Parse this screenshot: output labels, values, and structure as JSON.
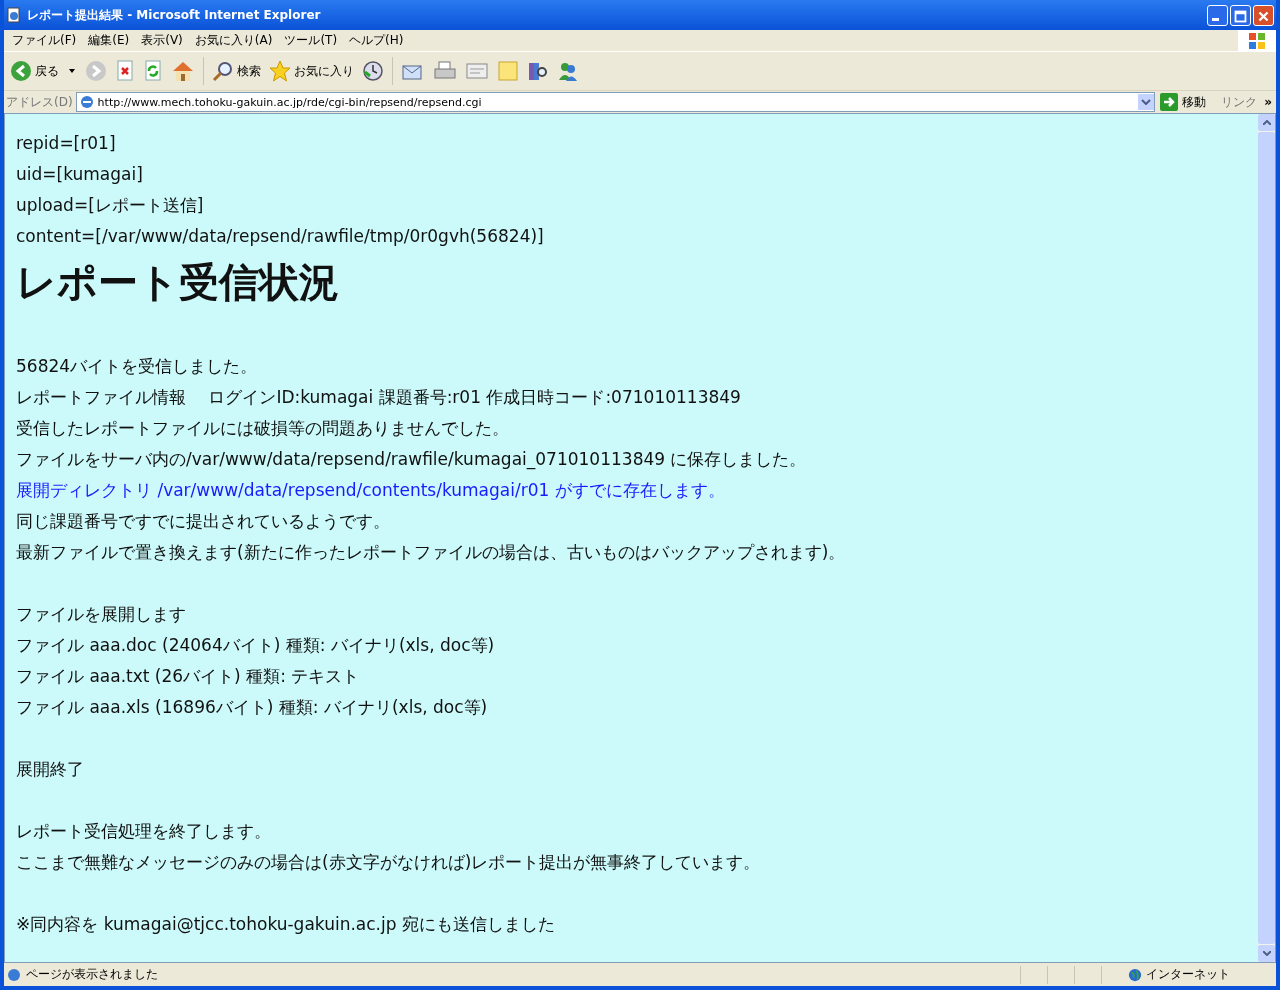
{
  "window": {
    "title": "レポート提出結果 - Microsoft Internet Explorer"
  },
  "menu": [
    {
      "label": "ファイル(F)"
    },
    {
      "label": "編集(E)"
    },
    {
      "label": "表示(V)"
    },
    {
      "label": "お気に入り(A)"
    },
    {
      "label": "ツール(T)"
    },
    {
      "label": "ヘルプ(H)"
    }
  ],
  "toolbar": {
    "back_label": "戻る",
    "search_label": "検索",
    "favorites_label": "お気に入り"
  },
  "address_bar": {
    "label": "アドレス(D)",
    "url": "http://www.mech.tohoku-gakuin.ac.jp/rde/cgi-bin/repsend/repsend.cgi",
    "go_label": "移動",
    "links_label": "リンク",
    "more": "»"
  },
  "content": [
    {
      "lines": [
        {
          "kind": "text",
          "text": "repid=[r01]"
        },
        {
          "kind": "text",
          "text": "uid=[kumagai]"
        },
        {
          "kind": "text",
          "text": "upload=[レポート送信]"
        },
        {
          "kind": "text",
          "text": "content=[/var/www/data/repsend/rawfile/tmp/0r0gvh(56824)]"
        },
        {
          "kind": "heading",
          "text": "レポート受信状況"
        }
      ]
    },
    {
      "lines": [
        {
          "kind": "text",
          "text": "56824バイトを受信しました。"
        },
        {
          "kind": "text",
          "text": "レポートファイル情報　 ログインID:kumagai 課題番号:r01 作成日時コード:071010113849"
        },
        {
          "kind": "text",
          "text": "受信したレポートファイルには破損等の問題ありませんでした。"
        },
        {
          "kind": "text",
          "text": "ファイルをサーバ内の/var/www/data/repsend/rawfile/kumagai_071010113849 に保存しました。"
        },
        {
          "kind": "notice",
          "text": "展開ディレクトリ /var/www/data/repsend/contents/kumagai/r01 がすでに存在します。"
        },
        {
          "kind": "text",
          "text": "同じ課題番号ですでに提出されているようです。"
        },
        {
          "kind": "text",
          "text": "最新ファイルで置き換えます(新たに作ったレポートファイルの場合は、古いものはバックアップされます)。"
        }
      ]
    },
    {
      "lines": [
        {
          "kind": "text",
          "text": "ファイルを展開します"
        },
        {
          "kind": "text",
          "text": "ファイル aaa.doc (24064バイト) 種類: バイナリ(xls, doc等)"
        },
        {
          "kind": "text",
          "text": "ファイル aaa.txt (26バイト) 種類: テキスト"
        },
        {
          "kind": "text",
          "text": "ファイル aaa.xls (16896バイト) 種類: バイナリ(xls, doc等)"
        }
      ]
    },
    {
      "lines": [
        {
          "kind": "text",
          "text": "展開終了"
        }
      ]
    },
    {
      "lines": [
        {
          "kind": "text",
          "text": "レポート受信処理を終了します。"
        },
        {
          "kind": "text",
          "text": "ここまで無難なメッセージのみの場合は(赤文字がなければ)レポート提出が無事終了しています。"
        }
      ]
    },
    {
      "lines": [
        {
          "kind": "text",
          "text": "※同内容を kumagai@tjcc.tohoku-gakuin.ac.jp 宛にも送信しました"
        }
      ]
    }
  ],
  "status_bar": {
    "message": "ページが表示されました",
    "zone": "インターネット"
  }
}
